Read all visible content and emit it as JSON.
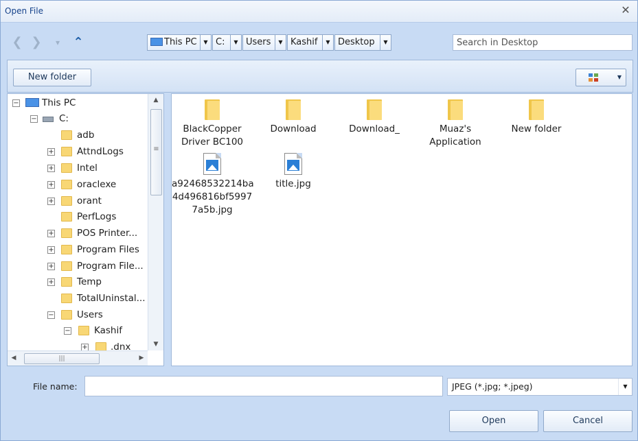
{
  "window": {
    "title": "Open File",
    "close_glyph": "✕"
  },
  "nav": {
    "back": "❮",
    "forward": "❯",
    "recent": "▾",
    "up": "⌃"
  },
  "breadcrumb": [
    {
      "label": "This PC",
      "icon": "this-pc-icon"
    },
    {
      "label": "C:"
    },
    {
      "label": "Users"
    },
    {
      "label": "Kashif"
    },
    {
      "label": "Desktop"
    }
  ],
  "dropdown_glyph": "▼",
  "search": {
    "placeholder": "Search in Desktop",
    "value": ""
  },
  "toolbar": {
    "new_folder_label": "New folder",
    "view_icon": "view-options-icon"
  },
  "tree": {
    "items": [
      {
        "label": "This PC",
        "icon": "this-pc-icon",
        "expander": "⊟"
      },
      {
        "label": "C:",
        "icon": "drive-icon",
        "expander": "⊟"
      },
      {
        "label": "adb",
        "expander": ""
      },
      {
        "label": "AttndLogs",
        "expander": "+"
      },
      {
        "label": "Intel",
        "expander": "+"
      },
      {
        "label": "oraclexe",
        "expander": "+"
      },
      {
        "label": "orant",
        "expander": "+"
      },
      {
        "label": "PerfLogs",
        "expander": ""
      },
      {
        "label": "POS  Printer...",
        "expander": "+"
      },
      {
        "label": "Program Files",
        "expander": "+"
      },
      {
        "label": "Program  File...",
        "expander": "+"
      },
      {
        "label": "Temp",
        "expander": "+"
      },
      {
        "label": "TotalUninstal...",
        "expander": ""
      },
      {
        "label": "Users",
        "expander": "−"
      },
      {
        "label": "Kashif",
        "expander": "−"
      },
      {
        "label": ".dnx",
        "expander": "+"
      }
    ]
  },
  "scroll_glyphs": {
    "up": "▲",
    "down": "▼",
    "left": "◀",
    "right": "▶",
    "grip": "|||",
    "grip_v": "≡"
  },
  "files": [
    {
      "name_line1": "BlackCopper",
      "name_line2": "Driver BC100",
      "name_line3": "",
      "type": "folder"
    },
    {
      "name_line1": "Download",
      "name_line2": "",
      "name_line3": "",
      "type": "folder"
    },
    {
      "name_line1": "Download_",
      "name_line2": "",
      "name_line3": "",
      "type": "folder"
    },
    {
      "name_line1": "Muaz's",
      "name_line2": "Application",
      "name_line3": "",
      "type": "folder"
    },
    {
      "name_line1": "New folder",
      "name_line2": "",
      "name_line3": "",
      "type": "folder"
    },
    {
      "name_line1": "a92468532214ba",
      "name_line2": "4d496816bf5997",
      "name_line3": "7a5b.jpg",
      "type": "image"
    },
    {
      "name_line1": "title.jpg",
      "name_line2": "",
      "name_line3": "",
      "type": "image"
    }
  ],
  "footer": {
    "file_name_label": "File name:",
    "file_name_value": "",
    "file_type_filter": "JPEG (*.jpg; *.jpeg)",
    "open_label": "Open",
    "cancel_label": "Cancel"
  },
  "colors": {
    "folder": "#f8d775",
    "accent": "#15428b",
    "frame": "#c8dbf4"
  }
}
